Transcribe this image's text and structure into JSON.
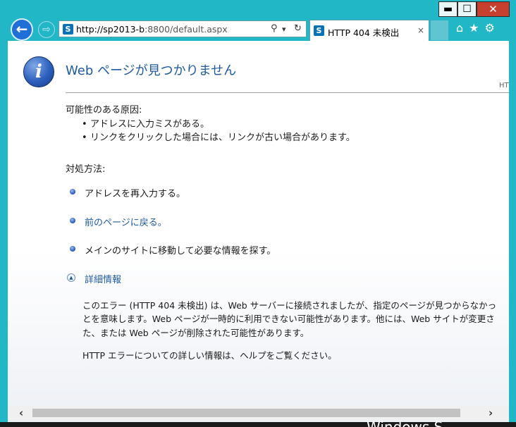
{
  "window": {
    "controls": {
      "minimize": "▬",
      "maximize": "☐",
      "close": "✕"
    }
  },
  "toolbar": {
    "back_icon": "←",
    "forward_icon": "⇨",
    "address": {
      "host": "http://sp2013-b",
      "rest": ":8800/default.aspx",
      "site_icon": "S"
    },
    "tools": {
      "search": "⚲",
      "dropdown": "▾",
      "refresh": "↻"
    },
    "tab": {
      "title": "HTTP 404 未検出",
      "close": "×",
      "site_icon": "S"
    },
    "right_icons": {
      "home": "⌂",
      "favorites": "★",
      "settings": "⚙"
    }
  },
  "page": {
    "heading": "Web ページが見つかりません",
    "http_stub": "HTT",
    "cause_title": "可能性のある原因:",
    "causes": [
      "アドレスに入力ミスがある。",
      "リンクをクリックした場合には、リンクが古い場合があります。"
    ],
    "action_title": "対処方法:",
    "actions": [
      "アドレスを再入力する。",
      "前のページに戻る。",
      "メインのサイトに移動して必要な情報を探す。"
    ],
    "more_info": "詳細情報",
    "details": [
      "このエラー (HTTP 404 未検出) は、Web サーバーに接続されましたが、指定のページが見つからなかっ",
      "とを意味します。Web ページが一時的に利用できない可能性があります。他には、Web サイトが変更さ",
      "た、または Web ページが削除された可能性があります。",
      "HTTP エラーについての詳しい情報は、ヘルプをご覧ください。"
    ]
  },
  "scrollbar": {
    "left": "‹",
    "right": "›"
  },
  "watermark": "Windows S"
}
